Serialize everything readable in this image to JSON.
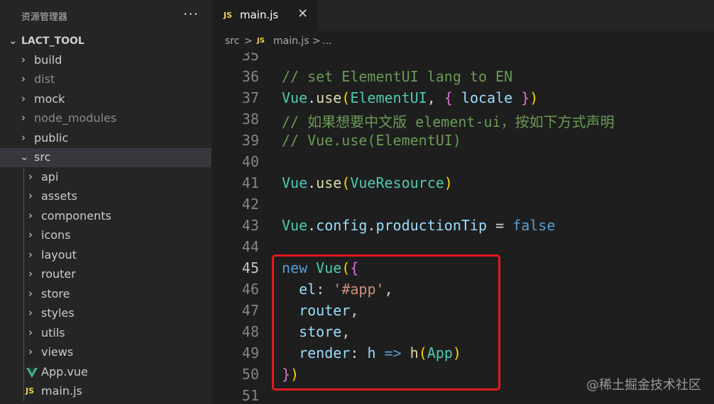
{
  "explorer": {
    "title": "资源管理器",
    "more": "···",
    "root": "LACT_TOOL",
    "items": [
      {
        "label": "build",
        "dim": false
      },
      {
        "label": "dist",
        "dim": true
      },
      {
        "label": "mock",
        "dim": false
      },
      {
        "label": "node_modules",
        "dim": true
      },
      {
        "label": "public",
        "dim": false
      },
      {
        "label": "src",
        "dim": false,
        "expanded": true
      },
      {
        "label": "api"
      },
      {
        "label": "assets"
      },
      {
        "label": "components"
      },
      {
        "label": "icons"
      },
      {
        "label": "layout"
      },
      {
        "label": "router"
      },
      {
        "label": "store"
      },
      {
        "label": "styles"
      },
      {
        "label": "utils"
      },
      {
        "label": "views"
      },
      {
        "label": "App.vue",
        "icon": "vue-icon"
      },
      {
        "label": "main.js",
        "icon": "JS"
      }
    ]
  },
  "tab": {
    "icon": "JS",
    "name": "main.js",
    "close": "✕"
  },
  "breadcrumb": {
    "part1": "src",
    "sep": ">",
    "icon": "JS",
    "part2": "main.js",
    "part3": "..."
  },
  "code": {
    "active_line": "45",
    "lines": [
      {
        "n": "35",
        "t": ""
      },
      {
        "n": "36",
        "t": "// set ElementUI lang to EN"
      },
      {
        "n": "37",
        "t": "Vue.use(ElementUI, { locale })"
      },
      {
        "n": "38",
        "t": "// 如果想要中文版 element-ui，按如下方式声明"
      },
      {
        "n": "39",
        "t": "// Vue.use(ElementUI)"
      },
      {
        "n": "40",
        "t": ""
      },
      {
        "n": "41",
        "t": "Vue.use(VueResource)"
      },
      {
        "n": "42",
        "t": ""
      },
      {
        "n": "43",
        "t": "Vue.config.productionTip = false"
      },
      {
        "n": "44",
        "t": ""
      },
      {
        "n": "45",
        "t": "new Vue({"
      },
      {
        "n": "46",
        "t": "  el: '#app',"
      },
      {
        "n": "47",
        "t": "  router,"
      },
      {
        "n": "48",
        "t": "  store,"
      },
      {
        "n": "49",
        "t": "  render: h => h(App)"
      },
      {
        "n": "50",
        "t": "})"
      },
      {
        "n": "51",
        "t": ""
      }
    ]
  },
  "watermark": "@稀土掘金技术社区",
  "colors": {
    "highlight": "#e5191c",
    "comment": "#6a9955",
    "keyword": "#569cd6"
  }
}
